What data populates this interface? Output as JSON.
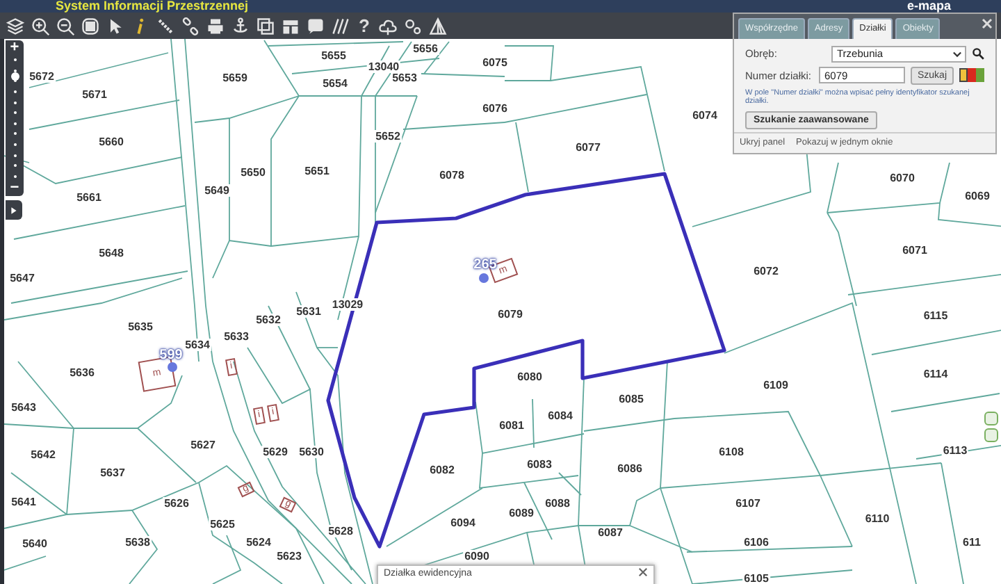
{
  "header": {
    "title": "System Informacji Przestrzennej",
    "brand": "e-mapa"
  },
  "toolbar": {
    "help_label": "?"
  },
  "zoom_control": {
    "plus": "+",
    "minus": "−",
    "level": 0.83
  },
  "search_panel": {
    "tabs": [
      {
        "label": "Współrzędne",
        "selected": false
      },
      {
        "label": "Adresy",
        "selected": false
      },
      {
        "label": "Działki",
        "selected": true
      },
      {
        "label": "Obiekty",
        "selected": false
      }
    ],
    "fields": [
      {
        "kind": "select",
        "label": "Obręb:",
        "value": "Trzebunia"
      },
      {
        "kind": "input",
        "label": "Numer działki:",
        "value": "6079"
      }
    ],
    "search_button": "Szukaj",
    "style_swatches": [
      {
        "color": "#f0c23c",
        "selected": true
      },
      {
        "color": "#d82a1e",
        "selected": false
      },
      {
        "color": "#6aa23a",
        "selected": false
      }
    ],
    "hint": "W pole \"Numer działki\" można wpisać pełny identyfikator szukanej działki.",
    "advanced_button": "Szukanie zaawansowane",
    "footer_links": [
      "Ukryj panel",
      "Pokazuj w jednym oknie"
    ]
  },
  "map": {
    "parcels": [
      {
        "number": "5672"
      },
      {
        "number": "5671"
      },
      {
        "number": "5659"
      },
      {
        "number": "5655"
      },
      {
        "number": "13040"
      },
      {
        "number": "5656"
      },
      {
        "number": "5654"
      },
      {
        "number": "5653"
      },
      {
        "number": "6075"
      },
      {
        "number": "5660"
      },
      {
        "number": "5652"
      },
      {
        "number": "6076"
      },
      {
        "number": "5650"
      },
      {
        "number": "5651"
      },
      {
        "number": "6078"
      },
      {
        "number": "5649"
      },
      {
        "number": "5661"
      },
      {
        "number": "5648"
      },
      {
        "number": "5647"
      },
      {
        "number": "6077"
      },
      {
        "number": "6074"
      },
      {
        "number": "6070"
      },
      {
        "number": "6069"
      },
      {
        "number": "6071"
      },
      {
        "number": "6072"
      },
      {
        "number": "6079"
      },
      {
        "number": "13029"
      },
      {
        "number": "5635"
      },
      {
        "number": "5634"
      },
      {
        "number": "5633"
      },
      {
        "number": "5632"
      },
      {
        "number": "5631"
      },
      {
        "number": "6115"
      },
      {
        "number": "5636"
      },
      {
        "number": "6080"
      },
      {
        "number": "6109"
      },
      {
        "number": "6114"
      },
      {
        "number": "5643"
      },
      {
        "number": "6085"
      },
      {
        "number": "6081"
      },
      {
        "number": "6084"
      },
      {
        "number": "5642"
      },
      {
        "number": "5627"
      },
      {
        "number": "5629"
      },
      {
        "number": "5630"
      },
      {
        "number": "6108"
      },
      {
        "number": "6113"
      },
      {
        "number": "6082"
      },
      {
        "number": "6083"
      },
      {
        "number": "6086"
      },
      {
        "number": "5637"
      },
      {
        "number": "5641"
      },
      {
        "number": "5626"
      },
      {
        "number": "5625"
      },
      {
        "number": "6094"
      },
      {
        "number": "6089"
      },
      {
        "number": "6088"
      },
      {
        "number": "6107"
      },
      {
        "number": "6110"
      },
      {
        "number": "5640"
      },
      {
        "number": "5638"
      },
      {
        "number": "5624"
      },
      {
        "number": "5628"
      },
      {
        "number": "6087"
      },
      {
        "number": "6106"
      },
      {
        "number": "611"
      },
      {
        "number": "5623"
      },
      {
        "number": "6090"
      },
      {
        "number": "6105"
      }
    ],
    "points": [
      {
        "label": "265"
      },
      {
        "label": "599"
      }
    ],
    "buildings": [
      {
        "label": "m"
      },
      {
        "label": "m"
      },
      {
        "label": "i"
      },
      {
        "label": "i"
      },
      {
        "label": "i"
      },
      {
        "label": "g"
      },
      {
        "label": "g"
      }
    ]
  },
  "info_popup": {
    "title": "Działka ewidencyjna"
  }
}
